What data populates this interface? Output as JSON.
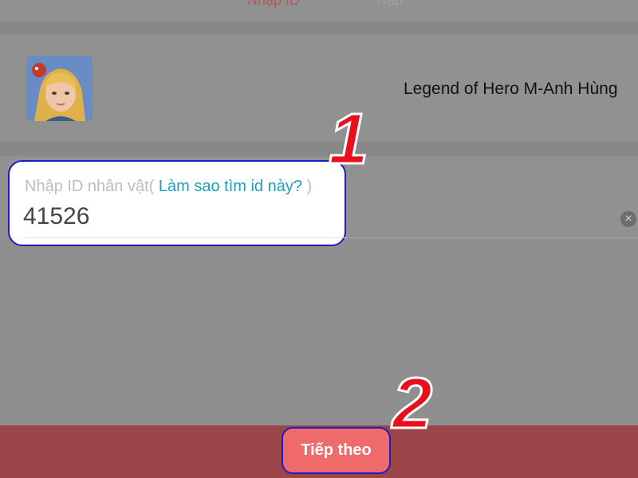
{
  "tabs": [
    {
      "label": "Nhập ID"
    },
    {
      "label": "Nạp"
    }
  ],
  "game": {
    "icon": "hero-portrait-icon",
    "title": "Legend of Hero M-Anh Hùng"
  },
  "form": {
    "label": "Nhập ID nhân vật(",
    "help_link": "Làm sao tìm id này?",
    "label_close": ")",
    "id_value": "41526",
    "clear_icon": "clear-icon"
  },
  "actions": {
    "next_label": "Tiếp theo"
  },
  "annotations": {
    "step1": "1",
    "step2": "2"
  },
  "colors": {
    "callout_border": "#1c1cc0",
    "step_number": "#e8101c",
    "next_button": "#ef6b6b",
    "bottom_bar": "#9b4548",
    "link": "#1aa0b8"
  }
}
